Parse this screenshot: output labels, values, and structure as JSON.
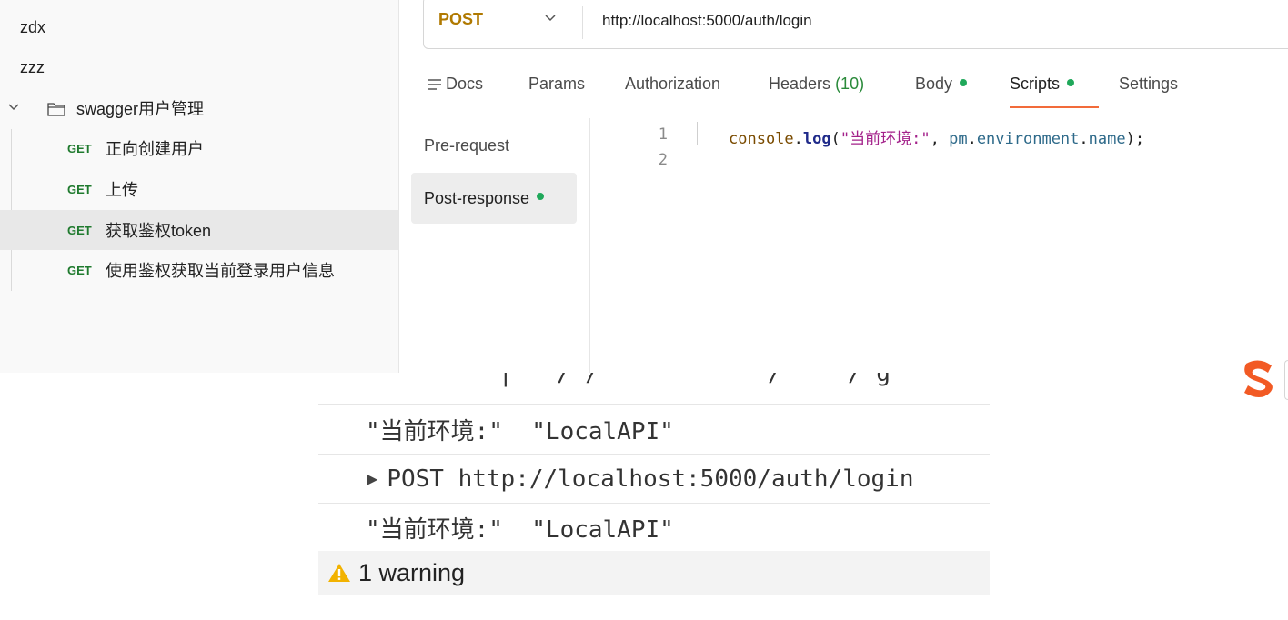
{
  "sidebar": {
    "items": [
      {
        "label": "zdx"
      },
      {
        "label": "zzz"
      },
      {
        "label": "swagger用户管理"
      }
    ],
    "requests": [
      {
        "method": "GET",
        "label": "正向创建用户"
      },
      {
        "method": "GET",
        "label": "上传"
      },
      {
        "method": "GET",
        "label": "获取鉴权token"
      },
      {
        "method": "GET",
        "label": "使用鉴权获取当前登录用户信息"
      }
    ]
  },
  "request": {
    "method": "POST",
    "url": "http://localhost:5000/auth/login"
  },
  "tabs": {
    "docs": "Docs",
    "params": "Params",
    "authorization": "Authorization",
    "headers": "Headers",
    "headers_count": "(10)",
    "body": "Body",
    "scripts": "Scripts",
    "settings": "Settings",
    "active": "Scripts"
  },
  "script_nav": {
    "pre": "Pre-request",
    "post": "Post-response"
  },
  "editor": {
    "line_numbers": [
      "1",
      "2"
    ],
    "code": {
      "obj": "console",
      "dot": ".",
      "fn": "log",
      "open": "(",
      "str": "\"当前环境:\"",
      "comma": ", ",
      "var": "pm",
      "dot2": ".",
      "prop1": "environment",
      "dot3": ".",
      "prop2": "name",
      "close": ");"
    }
  },
  "console": {
    "rows": [
      {
        "text": "\"当前环境:\"  \"LocalAPI\""
      },
      {
        "text": "POST http://localhost:5000/auth/login"
      },
      {
        "text": "\"当前环境:\"  \"LocalAPI\""
      }
    ],
    "warning": "1 warning"
  },
  "colors": {
    "get_method": "#1f7a2e",
    "post_method": "#b07900",
    "active_tab_underline": "#f26b3a",
    "status_dot": "#1fa85a",
    "warning": "#f2b200",
    "sogou": "#f25a24"
  },
  "icons": [
    "chevron-down-icon",
    "folder-icon",
    "docs-icon",
    "warning-icon",
    "sogou-ime-icon",
    "expand-triangle-icon"
  ]
}
